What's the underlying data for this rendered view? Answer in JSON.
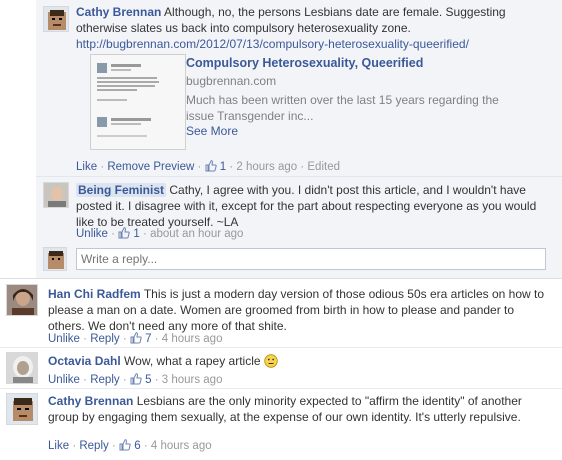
{
  "comments": [
    {
      "author": "Cathy Brennan",
      "text": "Although, no, the persons Lesbians date are female. Suggesting otherwise slates us back into compulsory heterosexuality zone.",
      "link": "http://bugbrennan.com/2012/07/13/compulsory-heterosexuality-queerified/",
      "preview": {
        "title": "Compulsory Heterosexuality, Queerified",
        "domain": "bugbrennan.com",
        "description": "Much has been written over the last 15 years regarding the issue Transgender inc...",
        "see_more": "See More"
      },
      "actions": {
        "like": "Like",
        "remove_preview": "Remove Preview",
        "likes_count": "1",
        "time": "2 hours ago",
        "edited": "Edited"
      }
    },
    {
      "author": "Being Feminist",
      "text": "Cathy, I agree with you. I didn't post this article, and I wouldn't have posted it. I disagree with it, except for the part about respecting everyone as you would like to be treated yourself. ~LA",
      "actions": {
        "unlike": "Unlike",
        "likes_count": "1",
        "time": "about an hour ago"
      }
    }
  ],
  "reply_box": {
    "placeholder": "Write a reply..."
  },
  "top_comments": [
    {
      "author": "Han Chi Radfem",
      "text": "This is just a modern day version of those odious 50s era articles on how to please a man on a date. Women are groomed from birth in how to please and pander to others. We don't need any more of that shite.",
      "actions": {
        "unlike": "Unlike",
        "reply": "Reply",
        "likes_count": "7",
        "time": "4 hours ago"
      }
    },
    {
      "author": "Octavia Dahl",
      "text": "Wow, what a rapey article",
      "actions": {
        "unlike": "Unlike",
        "reply": "Reply",
        "likes_count": "5",
        "time": "3 hours ago"
      }
    },
    {
      "author": "Cathy Brennan",
      "text": "Lesbians are the only minority expected to \"affirm the identity\" of another group by engaging them sexually, at the expense of our own identity. It's utterly repulsive.",
      "actions": {
        "like": "Like",
        "reply": "Reply",
        "likes_count": "6",
        "time": "4 hours ago"
      }
    }
  ],
  "colors": {
    "link": "#3b5998",
    "nested_bg": "#f2f4f8",
    "meta": "#6d84b4"
  }
}
